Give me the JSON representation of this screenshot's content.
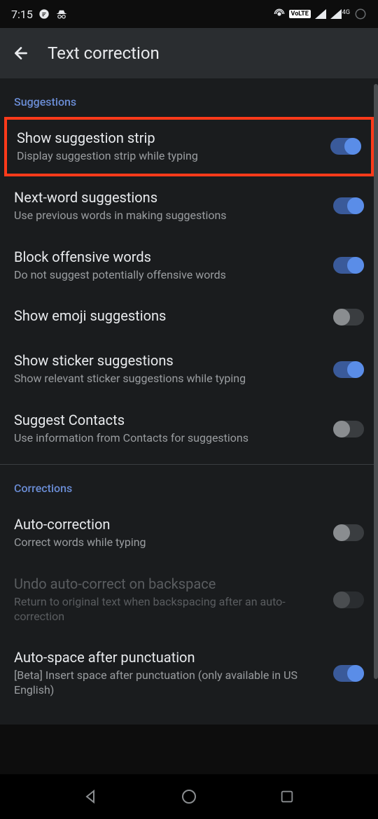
{
  "statusBar": {
    "time": "7:15",
    "volte": "VoLTE",
    "network": "4G"
  },
  "appBar": {
    "title": "Text correction"
  },
  "sections": {
    "suggestions": {
      "header": "Suggestions",
      "items": [
        {
          "title": "Show suggestion strip",
          "subtitle": "Display suggestion strip while typing",
          "enabled": true,
          "highlighted": true
        },
        {
          "title": "Next-word suggestions",
          "subtitle": "Use previous words in making suggestions",
          "enabled": true
        },
        {
          "title": "Block offensive words",
          "subtitle": "Do not suggest potentially offensive words",
          "enabled": true
        },
        {
          "title": "Show emoji suggestions",
          "subtitle": "",
          "enabled": false
        },
        {
          "title": "Show sticker suggestions",
          "subtitle": "Show relevant sticker suggestions while typing",
          "enabled": true
        },
        {
          "title": "Suggest Contacts",
          "subtitle": "Use information from Contacts for suggestions",
          "enabled": false
        }
      ]
    },
    "corrections": {
      "header": "Corrections",
      "items": [
        {
          "title": "Auto-correction",
          "subtitle": "Correct words while typing",
          "enabled": false
        },
        {
          "title": "Undo auto-correct on backspace",
          "subtitle": "Return to original text when backspacing after an auto-correction",
          "enabled": false,
          "disabled": true
        },
        {
          "title": "Auto-space after punctuation",
          "subtitle": "[Beta] Insert space after punctuation (only available in US English)",
          "enabled": true
        }
      ]
    }
  }
}
